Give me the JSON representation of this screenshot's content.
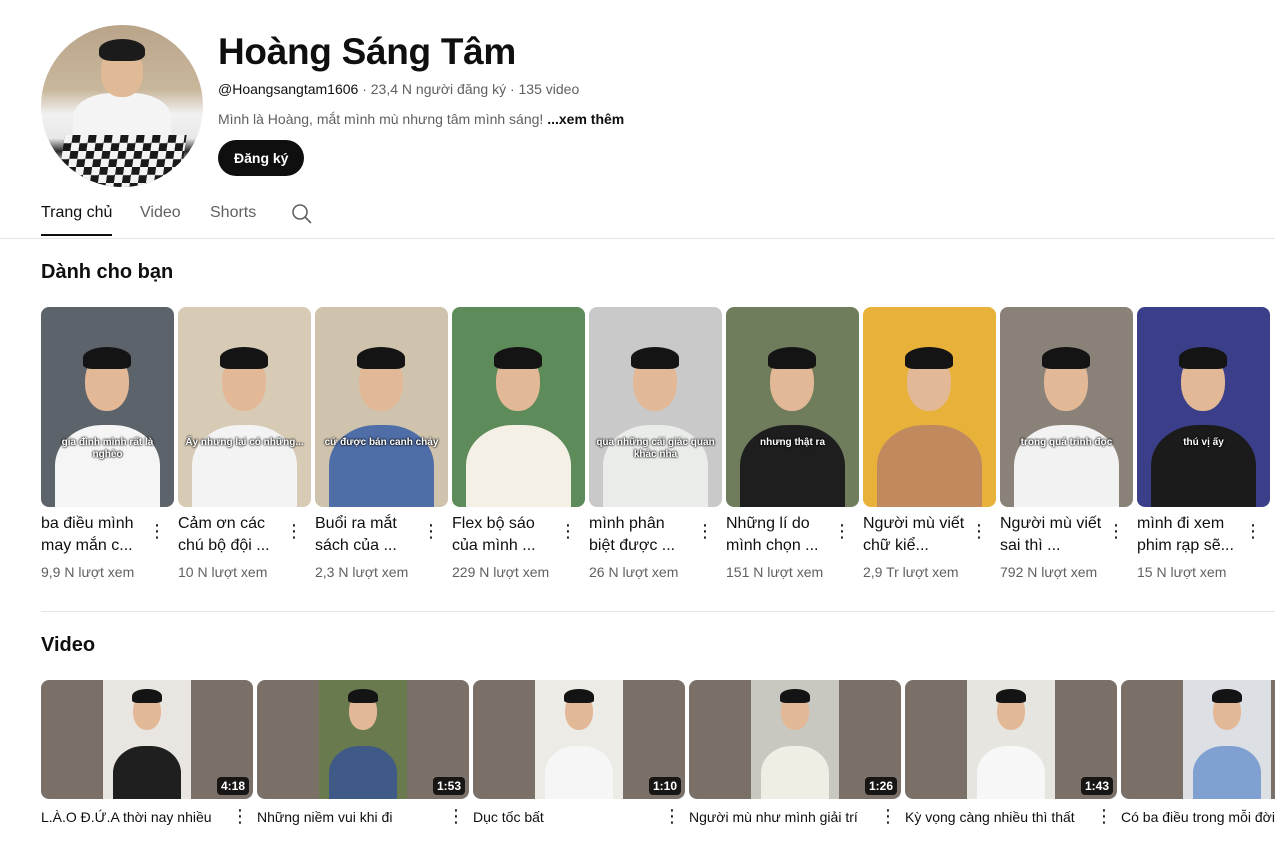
{
  "channel": {
    "name": "Hoàng Sáng Tâm",
    "handle": "@Hoangsangtam1606",
    "subscribers": "23,4 N người đăng ký",
    "video_count": "135 video",
    "separator": "·",
    "description": "Mình là Hoàng, mắt mình mù nhưng tâm mình sáng!",
    "more_label": "...xem thêm",
    "subscribe_label": "Đăng ký"
  },
  "tabs": [
    {
      "label": "Trang chủ",
      "active": true
    },
    {
      "label": "Video",
      "active": false
    },
    {
      "label": "Shorts",
      "active": false
    }
  ],
  "sections": {
    "for_you": "Dành cho bạn",
    "videos": "Video"
  },
  "shorts": [
    {
      "title": "ba điều mình may mắn c...",
      "views": "9,9 N lượt xem",
      "caption": "gia đình mình rất là nghèo",
      "bg": "#5d636a",
      "body": "#f5f5f5"
    },
    {
      "title": "Cảm ơn các chú bộ đội ...",
      "views": "10 N lượt xem",
      "caption": "Ấy nhưng lại có những...",
      "bg": "#d8cbb6",
      "body": "#f3f3f3"
    },
    {
      "title": "Buổi ra mắt sách của ...",
      "views": "2,3 N lượt xem",
      "caption": "cứ được bán canh chảy",
      "bg": "#cfc3ad",
      "body": "#4f6ea8"
    },
    {
      "title": "Flex bộ sáo của mình ...",
      "views": "229 N lượt xem",
      "caption": "",
      "bg": "#5e8b5a",
      "body": "#f5f0e6"
    },
    {
      "title": "mình phân biệt được ...",
      "views": "26 N lượt xem",
      "caption": "qua những cái giác quan khác nha",
      "bg": "#c9c9c9",
      "body": "#e9ece8"
    },
    {
      "title": "Những lí do mình chọn ...",
      "views": "151 N lượt xem",
      "caption": "nhưng thật ra",
      "bg": "#6f7d5d",
      "body": "#1e1e1e"
    },
    {
      "title": "Người mù viết chữ kiể...",
      "views": "2,9 Tr lượt xem",
      "caption": "",
      "bg": "#e8b23a",
      "body": "#c08a5e"
    },
    {
      "title": "Người mù viết sai thì ...",
      "views": "792 N lượt xem",
      "caption": "trong quá trình đọc",
      "bg": "#8a8178",
      "body": "#f2f2f2"
    },
    {
      "title": "mình đi xem phim rạp sẽ...",
      "views": "15 N lượt xem",
      "caption": "thú vị ấy",
      "bg": "#3b3f8a",
      "body": "#1b1b1b"
    }
  ],
  "videos": [
    {
      "title": "L.À.O Đ.Ứ.A thời nay nhiều",
      "duration": "4:18",
      "inner": "#e9e6e2",
      "body": "#1f1f1f"
    },
    {
      "title": "Những niềm vui khi đi",
      "duration": "1:53",
      "inner": "#6a7a4f",
      "body": "#3f5a86"
    },
    {
      "title": "Dục tốc bất",
      "duration": "1:10",
      "inner": "#ecebe6",
      "body": "#f6f6f6"
    },
    {
      "title": "Người mù như mình giải trí",
      "duration": "1:26",
      "inner": "#c8c7c0",
      "body": "#f0ede4"
    },
    {
      "title": "Kỳ vọng càng nhiều thì thất",
      "duration": "1:43",
      "inner": "#e7e5df",
      "body": "#f7f7f7"
    },
    {
      "title": "Có ba điều trong mỗi đời",
      "duration": "",
      "inner": "#dcdfe4",
      "body": "#7fa0d0"
    }
  ]
}
